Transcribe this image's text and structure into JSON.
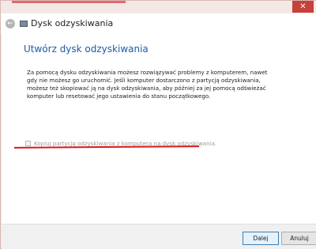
{
  "window": {
    "close_glyph": "✕",
    "accent_color": "#e06c6c"
  },
  "nav": {
    "back_glyph": "←",
    "title": "Dysk odzyskiwania"
  },
  "main": {
    "heading": "Utwórz dysk odzyskiwania",
    "description": "Za pomocą dysku odzyskiwania możesz rozwiązywać problemy z komputerem, nawet gdy nie możesz go uruchomić. Jeśli komputer dostarczono z partycją odzyskiwania, możesz też skopiować ją na dysk odzyskiwania, aby później za jej pomocą odświeżać komputer lub resetować jego ustawienia do stanu początkowego.",
    "copy_option": {
      "label": "Kopiuj partycję odzyskiwania z komputera na dysk odzyskiwania.",
      "checked": false,
      "enabled": false
    },
    "annotation_color": "#d81818"
  },
  "footer": {
    "next_label": "Dalej",
    "cancel_label": "Anuluj"
  }
}
